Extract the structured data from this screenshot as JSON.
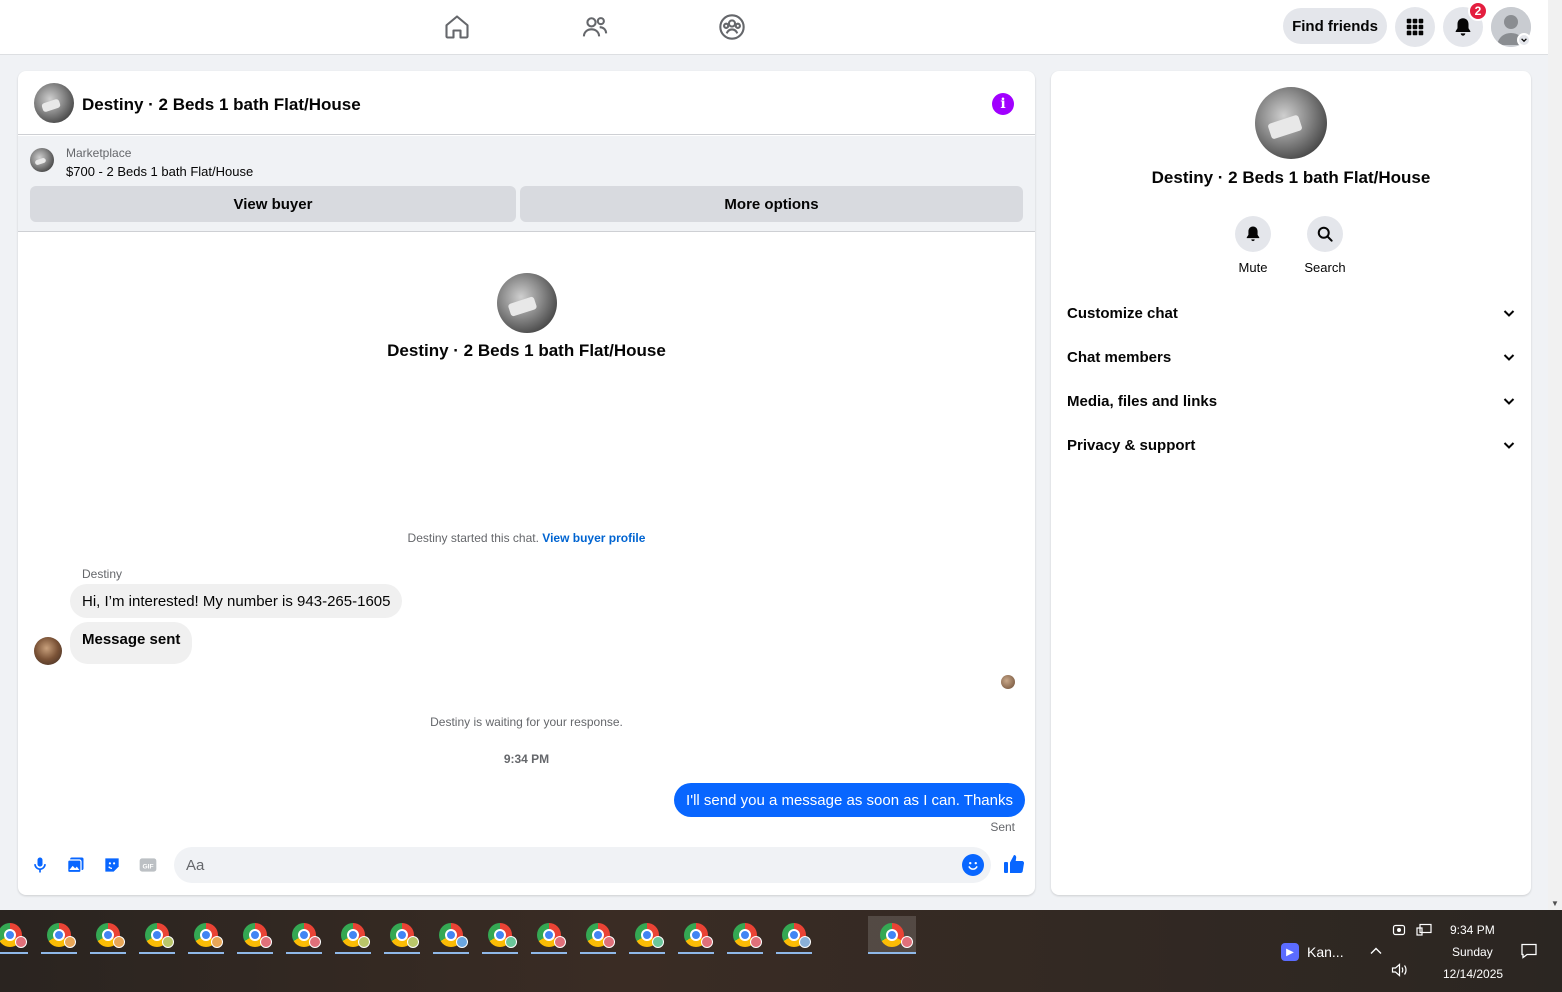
{
  "topbar": {
    "find_friends_label": "Find friends",
    "notification_count": "2",
    "icons": [
      "home-icon",
      "friends-icon",
      "groups-icon",
      "menu-grid-icon",
      "bell-icon",
      "account-avatar"
    ]
  },
  "chat": {
    "title": "Destiny · 2 Beds 1 bath Flat/House",
    "marketplace": {
      "label": "Marketplace",
      "listing": "$700 - 2 Beds 1 bath Flat/House",
      "view_buyer_label": "View buyer",
      "more_options_label": "More options"
    },
    "center_name": "Destiny · 2 Beds 1 bath Flat/House",
    "started_text": "Destiny started this chat.",
    "view_buyer_profile": "View buyer profile",
    "sender_name": "Destiny",
    "incoming_messages": [
      "Hi, I’m interested! My number is 943-265-1605",
      "Message sent"
    ],
    "waiting_text": "Destiny is waiting for your response.",
    "timestamp": "9:34 PM",
    "outgoing_message": "I'll send you a message as soon as I can. Thanks",
    "sent_status": "Sent",
    "composer_placeholder": "Aa"
  },
  "info_panel": {
    "name": "Destiny · 2 Beds 1 bath Flat/House",
    "mute_label": "Mute",
    "search_label": "Search",
    "sections": [
      "Customize chat",
      "Chat members",
      "Media, files and links",
      "Privacy & support"
    ]
  },
  "taskbar": {
    "app_label": "Kan...",
    "time": "9:34 PM",
    "day": "Sunday",
    "date": "12/14/2025"
  },
  "colors": {
    "accent": "#0866ff",
    "info_purple": "#a100ff",
    "badge_red": "#e41e3f"
  }
}
